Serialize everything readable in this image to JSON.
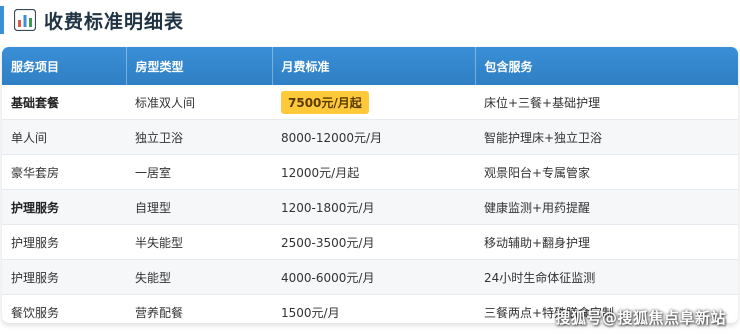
{
  "header": {
    "title": "收费标准明细表",
    "icon": "bar-chart-icon"
  },
  "table": {
    "columns": [
      "服务项目",
      "房型类型",
      "月费标准",
      "包含服务"
    ],
    "rows": [
      {
        "item": "基础套餐",
        "room": "标准双人间",
        "fee": "7500元/月起",
        "services": "床位+三餐+基础护理",
        "bold": true,
        "fee_highlight": true
      },
      {
        "item": "单人间",
        "room": "独立卫浴",
        "fee": "8000-12000元/月",
        "services": "智能护理床+独立卫浴"
      },
      {
        "item": "豪华套房",
        "room": "一居室",
        "fee": "12000元/月起",
        "services": "观景阳台+专属管家"
      },
      {
        "item": "护理服务",
        "room": "自理型",
        "fee": "1200-1800元/月",
        "services": "健康监测+用药提醒",
        "bold": true
      },
      {
        "item": "护理服务",
        "room": "半失能型",
        "fee": "2500-3500元/月",
        "services": "移动辅助+翻身护理"
      },
      {
        "item": "护理服务",
        "room": "失能型",
        "fee": "4000-6000元/月",
        "services": "24小时生命体征监测"
      },
      {
        "item": "餐饮服务",
        "room": "营养配餐",
        "fee": "1500元/月",
        "services": "三餐两点+特殊膳食定制"
      }
    ]
  },
  "watermark": "搜狐号@搜狐焦点阜新站",
  "colors": {
    "header_blue": "#3a8fd6",
    "highlight": "#ffc93a"
  }
}
